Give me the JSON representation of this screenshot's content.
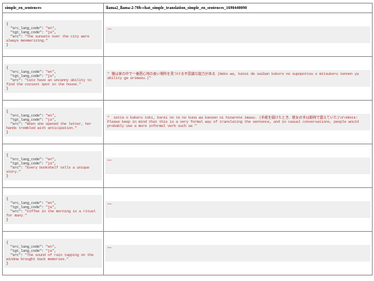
{
  "table": {
    "headers": [
      "simple_en_sentences",
      "llama2_llama-2-70b-chat_simple_translation_simple_en_sentences_1690440090"
    ],
    "rows": [
      {
        "src_lang_code": "en",
        "tgt_lang_code": "ja",
        "src": "The sunsets over the city were always mesmerizing.",
        "output": "\"\""
      },
      {
        "src_lang_code": "en",
        "tgt_lang_code": "ja",
        "src": "Cats have an uncanny ability to find the coziest spot in the house.",
        "output": "\" 猫は家の中で一番居心地の良い場所を見つける不思議な能力がある (Neko wa, katei de saiban kokoro no supopottsu o mitsukeru tennen ya ability ga arimasu.)\""
      },
      {
        "src_lang_code": "en",
        "tgt_lang_code": "ja",
        "src": "When she opened the letter, her hands trembled with anticipation.",
        "output": "\"  ietta o kakeru toki, karei no te no kuna wa kanzen ni hinarete imasu. (手紙を開けたとき、彼女の手は期待で震えていた)\\n\\nNote: Please keep in mind that this is a very formal way of translating the sentence, and in casual conversations, people would probably use a more informal verb such as \""
      },
      {
        "src_lang_code": "en",
        "tgt_lang_code": "ja",
        "src": "Every bookshelf tells a unique story.",
        "output": "\"\""
      },
      {
        "src_lang_code": "en",
        "tgt_lang_code": "ja",
        "src": "Coffee in the morning is a ritual for many.",
        "output": "\"\""
      },
      {
        "src_lang_code": "en",
        "tgt_lang_code": "ja",
        "src": "The sound of rain tapping on the window brought back memories.",
        "output": "\"\""
      }
    ]
  }
}
